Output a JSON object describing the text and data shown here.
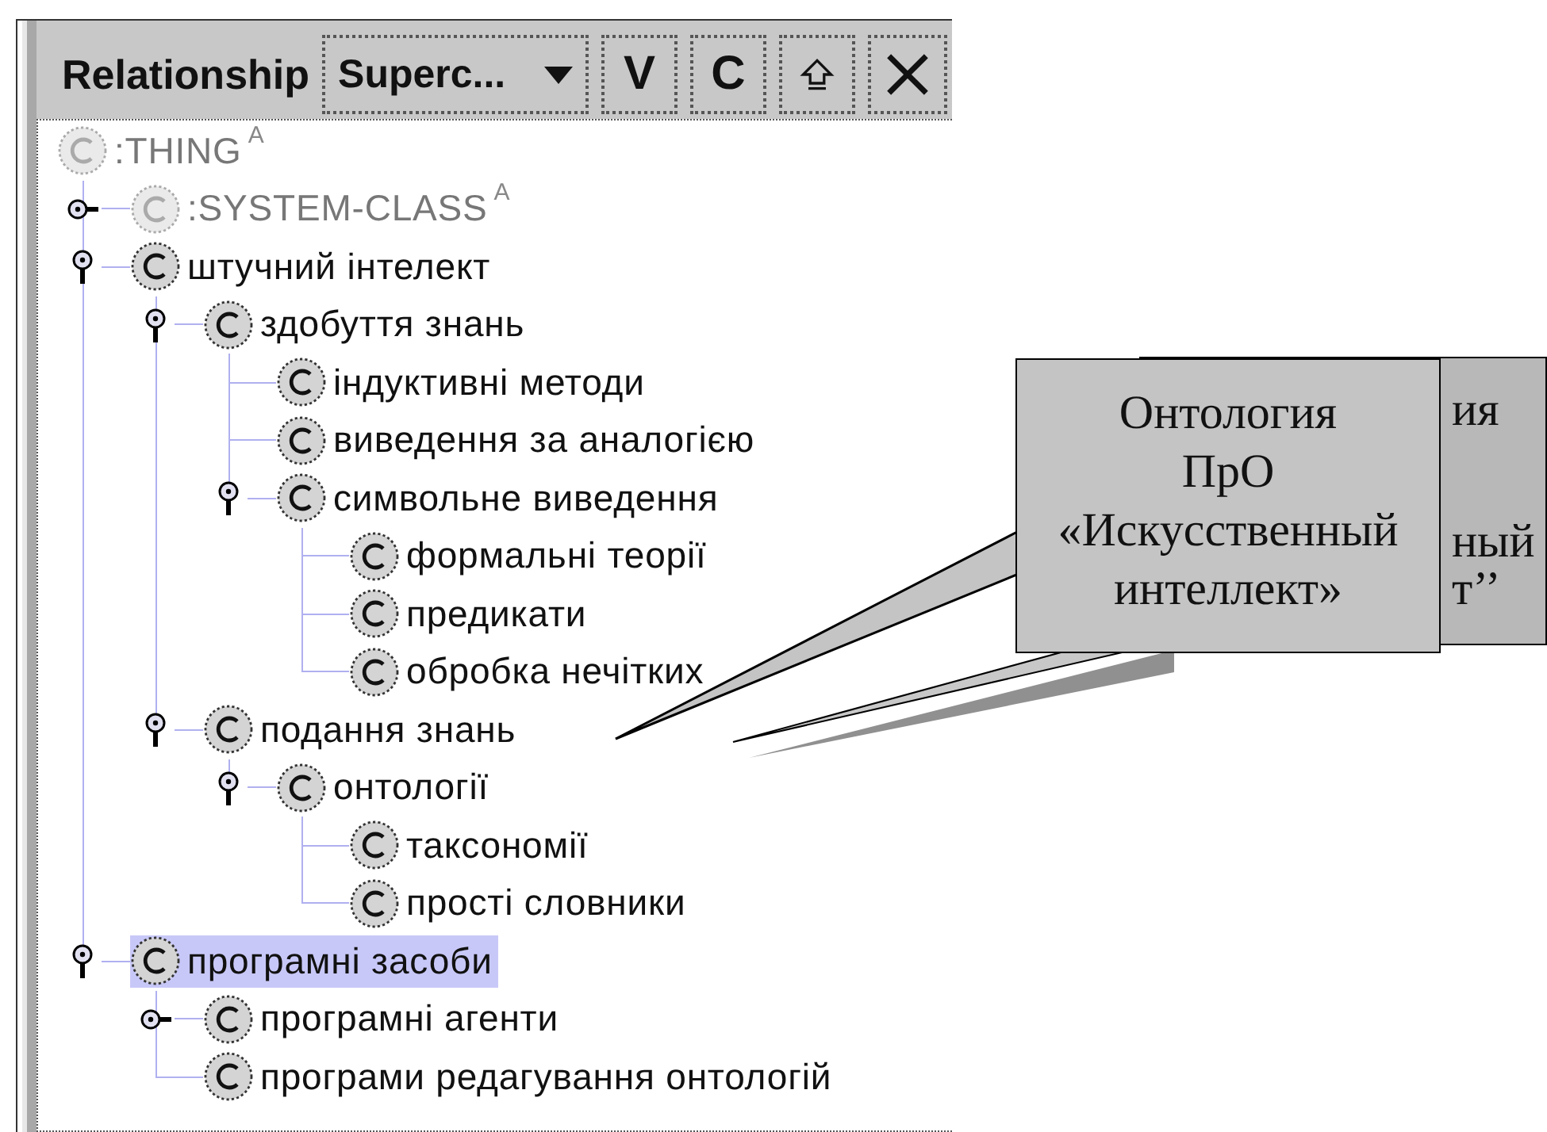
{
  "header": {
    "label": "Relationship",
    "dropdown": "Superc...",
    "buttons": [
      {
        "kind": "text",
        "label": "V"
      },
      {
        "kind": "text",
        "label": "C"
      },
      {
        "kind": "up"
      },
      {
        "kind": "close"
      }
    ]
  },
  "tree": [
    {
      "label": ":THING",
      "badge": "A",
      "system": true,
      "selected": false,
      "children": [
        {
          "label": ":SYSTEM-CLASS",
          "badge": "A",
          "system": true,
          "selected": false,
          "expanded": false
        },
        {
          "label": "штучний інтелект",
          "system": false,
          "selected": false,
          "expanded": true,
          "children": [
            {
              "label": "здобуття знань",
              "system": false,
              "selected": false,
              "expanded": true,
              "children": [
                {
                  "label": "індуктивні методи",
                  "system": false,
                  "selected": false
                },
                {
                  "label": "виведення за аналогією",
                  "system": false,
                  "selected": false
                },
                {
                  "label": "символьне виведення",
                  "system": false,
                  "selected": false,
                  "expanded": true,
                  "children": [
                    {
                      "label": "формальні теорії",
                      "system": false,
                      "selected": false
                    },
                    {
                      "label": "предикати",
                      "system": false,
                      "selected": false
                    },
                    {
                      "label": "обробка нечітких",
                      "system": false,
                      "selected": false
                    }
                  ]
                }
              ]
            },
            {
              "label": "подання знань",
              "system": false,
              "selected": false,
              "expanded": true,
              "children": [
                {
                  "label": "онтології",
                  "system": false,
                  "selected": false,
                  "expanded": true,
                  "children": [
                    {
                      "label": "таксономії",
                      "system": false,
                      "selected": false
                    },
                    {
                      "label": "прості словники",
                      "system": false,
                      "selected": false
                    }
                  ]
                }
              ]
            }
          ]
        },
        {
          "label": "програмні засоби",
          "system": false,
          "selected": true,
          "expanded": true,
          "children": [
            {
              "label": "програмні агенти",
              "system": false,
              "selected": false,
              "expanded": false
            },
            {
              "label": "програми редагування онтологій",
              "system": false,
              "selected": false
            }
          ]
        }
      ]
    }
  ],
  "callouts": [
    {
      "kind": "front",
      "lines": [
        "Онтология",
        "ПрО",
        "«Искусственный",
        "интеллект»"
      ]
    },
    {
      "kind": "back",
      "lines": [
        "ия",
        "ный",
        "т’’"
      ]
    }
  ]
}
